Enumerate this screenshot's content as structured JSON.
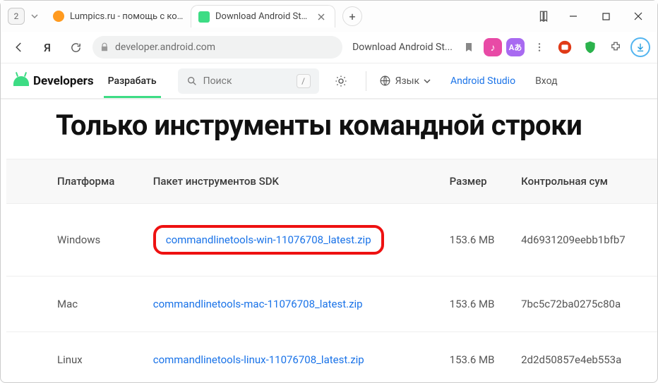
{
  "window": {
    "tab_badge": "2",
    "tabs": [
      {
        "label": "Lumpics.ru - помощь с ком",
        "active": false,
        "fav_color": "#ff9a1f"
      },
      {
        "label": "Download Android Studi",
        "active": true,
        "fav_color": "#3ddc84"
      }
    ]
  },
  "addressbar": {
    "host": "developer.android.com",
    "page_title": "Download Android St...",
    "search_icon": "search-icon"
  },
  "site_header": {
    "brand": "Developers",
    "nav": {
      "develop": "Разрабать"
    },
    "search_placeholder": "Поиск",
    "search_hotkey": "/",
    "language_label": "Язык",
    "android_studio": "Android Studio",
    "signin": "Вход"
  },
  "page": {
    "heading": "Только инструменты командной строки",
    "columns": {
      "platform": "Платформа",
      "package": "Пакет инструментов SDK",
      "size": "Размер",
      "checksum": "Контрольная сум"
    },
    "rows": [
      {
        "platform": "Windows",
        "package": "commandlinetools-win-11076708_latest.zip",
        "size": "153.6 MB",
        "checksum": "4d6931209eebb1bfb7",
        "highlight": true
      },
      {
        "platform": "Mac",
        "package": "commandlinetools-mac-11076708_latest.zip",
        "size": "153.6 MB",
        "checksum": "7bc5c72ba0275c80a",
        "highlight": false
      },
      {
        "platform": "Linux",
        "package": "commandlinetools-linux-11076708_latest.zip",
        "size": "153.6 MB",
        "checksum": "2d2d50857e4eb553a",
        "highlight": false
      }
    ]
  }
}
